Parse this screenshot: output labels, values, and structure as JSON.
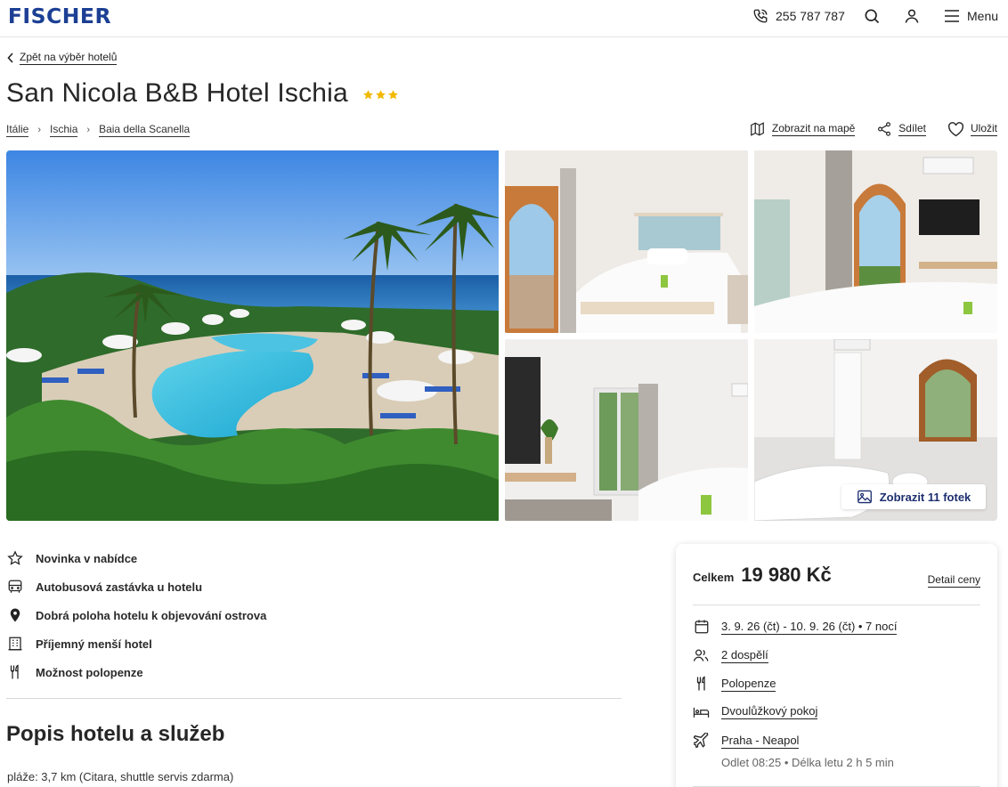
{
  "header": {
    "logo": "FISCHER",
    "phone": "255 787 787",
    "menu_label": "Menu"
  },
  "nav": {
    "back_label": "Zpět na výběr hotelů"
  },
  "hotel": {
    "name": "San Nicola B&B Hotel Ischia",
    "stars": 3
  },
  "breadcrumb": [
    "Itálie",
    "Ischia",
    "Baia della Scanella"
  ],
  "actions": {
    "map": "Zobrazit na mapě",
    "share": "Sdílet",
    "save": "Uložit"
  },
  "gallery": {
    "show_photos": "Zobrazit 11 fotek"
  },
  "features": [
    {
      "icon": "star-icon",
      "label": "Novinka v nabídce"
    },
    {
      "icon": "bus-icon",
      "label": "Autobusová zastávka u hotelu"
    },
    {
      "icon": "location-pin-icon",
      "label": "Dobrá poloha hotelu k objevování ostrova"
    },
    {
      "icon": "building-icon",
      "label": "Příjemný menší hotel"
    },
    {
      "icon": "cutlery-icon",
      "label": "Možnost polopenze"
    }
  ],
  "description": {
    "title": "Popis hotelu a služeb",
    "first_line": "pláže: 3,7 km (Citara, shuttle servis zdarma)"
  },
  "price_card": {
    "total_label": "Celkem",
    "total_value": "19 980 Kč",
    "detail_link": "Detail ceny",
    "dates": "3. 9. 26 (čt) - 10. 9. 26 (čt) • 7 nocí",
    "travellers": "2 dospělí",
    "board": "Polopenze",
    "room": "Dvoulůžkový pokoj",
    "flight": "Praha - Neapol",
    "flight_info": "Odlet 08:25 • Délka letu 2 h 5 min"
  },
  "colors": {
    "brand": "#1c3f94",
    "star": "#f2b900",
    "text": "#222222"
  }
}
